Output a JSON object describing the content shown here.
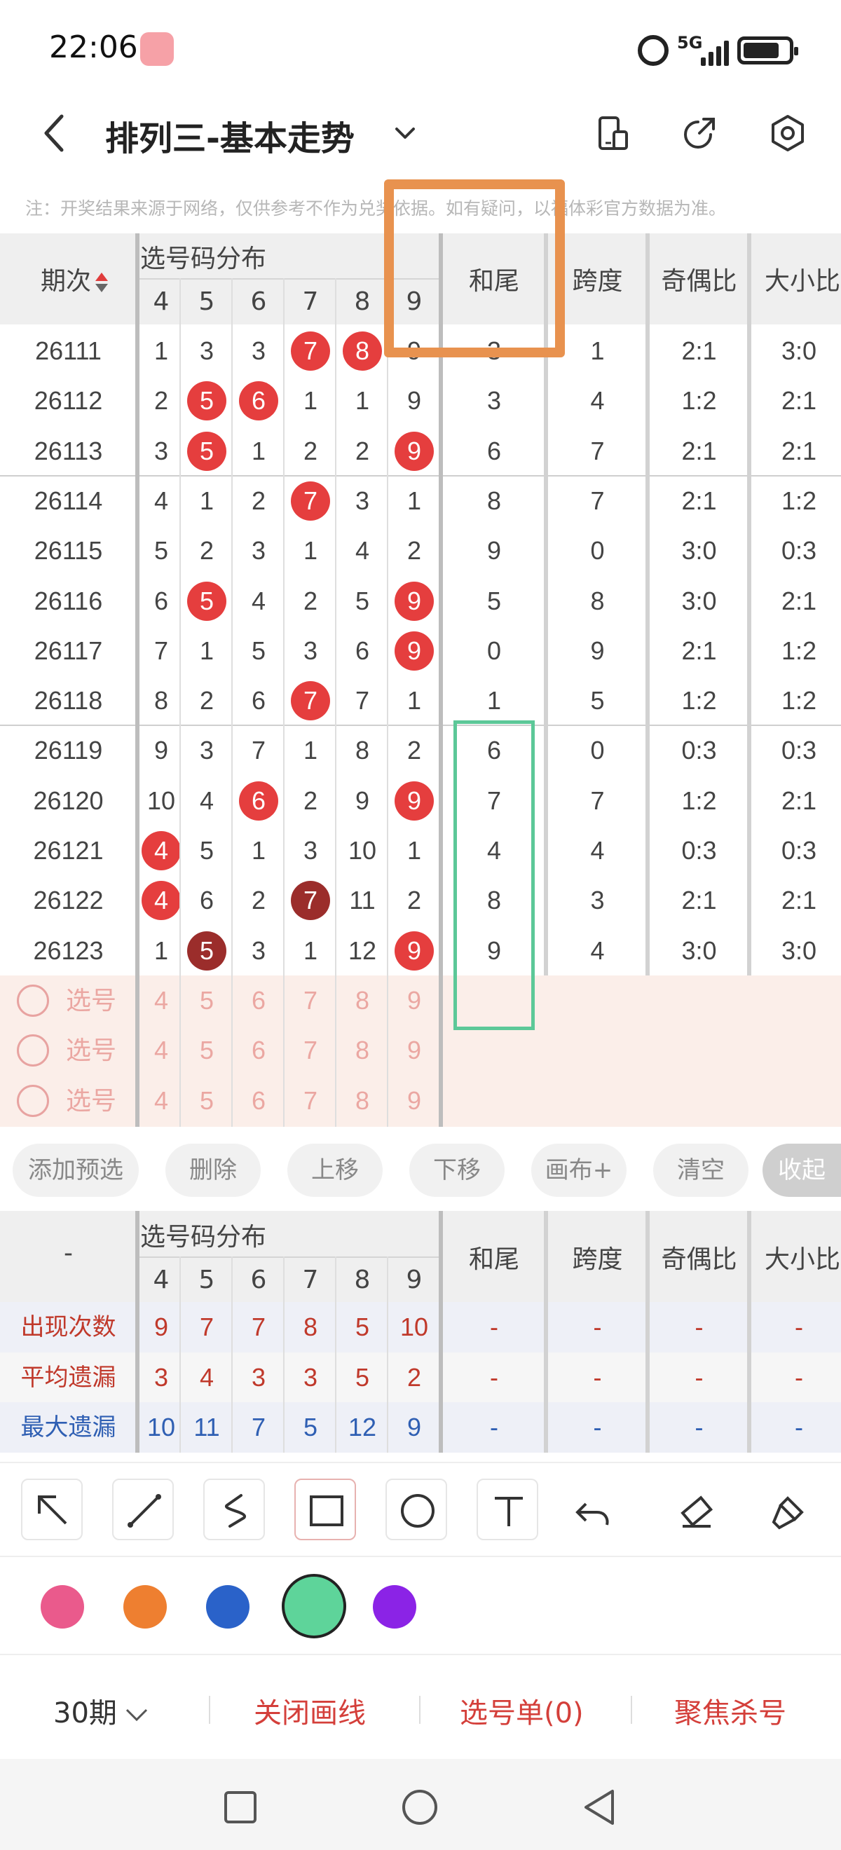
{
  "status_bar": {
    "time": "22:06",
    "network": "5G"
  },
  "header": {
    "title": "排列三-基本走势"
  },
  "notice": "注：开奖结果来源于网络，仅供参考不作为兑奖依据。如有疑问，以福体彩官方数据为准。",
  "table": {
    "col_period": "期次",
    "col_group": "选号码分布",
    "digits": [
      "4",
      "5",
      "6",
      "7",
      "8",
      "9"
    ],
    "col_hewei": "和尾",
    "col_kuadu": "跨度",
    "col_jiou": "奇偶比",
    "col_daxiao": "大小比",
    "rows": [
      {
        "period": "26111",
        "nums": [
          "1",
          "3",
          "3",
          "7",
          "8",
          "9"
        ],
        "hits": [
          0,
          0,
          0,
          1,
          1,
          0
        ],
        "hewei": "3",
        "kuadu": "1",
        "jiou": "2:1",
        "daxiao": "3:0"
      },
      {
        "period": "26112",
        "nums": [
          "2",
          "5",
          "6",
          "1",
          "1",
          "9"
        ],
        "hits": [
          0,
          1,
          1,
          0,
          0,
          0
        ],
        "hewei": "3",
        "kuadu": "4",
        "jiou": "1:2",
        "daxiao": "2:1"
      },
      {
        "period": "26113",
        "nums": [
          "3",
          "5",
          "1",
          "2",
          "2",
          "9"
        ],
        "hits": [
          0,
          1,
          0,
          0,
          0,
          1
        ],
        "hewei": "6",
        "kuadu": "7",
        "jiou": "2:1",
        "daxiao": "2:1"
      },
      {
        "period": "26114",
        "nums": [
          "4",
          "1",
          "2",
          "7",
          "3",
          "1"
        ],
        "hits": [
          0,
          0,
          0,
          1,
          0,
          0
        ],
        "hewei": "8",
        "kuadu": "7",
        "jiou": "2:1",
        "daxiao": "1:2"
      },
      {
        "period": "26115",
        "nums": [
          "5",
          "2",
          "3",
          "1",
          "4",
          "2"
        ],
        "hits": [
          0,
          0,
          0,
          0,
          0,
          0
        ],
        "hewei": "9",
        "kuadu": "0",
        "jiou": "3:0",
        "daxiao": "0:3"
      },
      {
        "period": "26116",
        "nums": [
          "6",
          "5",
          "4",
          "2",
          "5",
          "9"
        ],
        "hits": [
          0,
          1,
          0,
          0,
          0,
          1
        ],
        "hewei": "5",
        "kuadu": "8",
        "jiou": "3:0",
        "daxiao": "2:1"
      },
      {
        "period": "26117",
        "nums": [
          "7",
          "1",
          "5",
          "3",
          "6",
          "9"
        ],
        "hits": [
          0,
          0,
          0,
          0,
          0,
          1
        ],
        "hewei": "0",
        "kuadu": "9",
        "jiou": "2:1",
        "daxiao": "1:2"
      },
      {
        "period": "26118",
        "nums": [
          "8",
          "2",
          "6",
          "7",
          "7",
          "1"
        ],
        "hits": [
          0,
          0,
          0,
          1,
          0,
          0
        ],
        "hewei": "1",
        "kuadu": "5",
        "jiou": "1:2",
        "daxiao": "1:2"
      },
      {
        "period": "26119",
        "nums": [
          "9",
          "3",
          "7",
          "1",
          "8",
          "2"
        ],
        "hits": [
          0,
          0,
          0,
          0,
          0,
          0
        ],
        "hewei": "6",
        "kuadu": "0",
        "jiou": "0:3",
        "daxiao": "0:3"
      },
      {
        "period": "26120",
        "nums": [
          "10",
          "4",
          "6",
          "2",
          "9",
          "9"
        ],
        "hits": [
          0,
          0,
          1,
          0,
          0,
          1
        ],
        "hewei": "7",
        "kuadu": "7",
        "jiou": "1:2",
        "daxiao": "2:1"
      },
      {
        "period": "26121",
        "nums": [
          "4",
          "5",
          "1",
          "3",
          "10",
          "1"
        ],
        "hits": [
          1,
          0,
          0,
          0,
          0,
          0
        ],
        "hewei": "4",
        "kuadu": "4",
        "jiou": "0:3",
        "daxiao": "0:3"
      },
      {
        "period": "26122",
        "nums": [
          "4",
          "6",
          "2",
          "7",
          "11",
          "2"
        ],
        "hits": [
          1,
          0,
          0,
          2,
          0,
          0
        ],
        "hewei": "8",
        "kuadu": "3",
        "jiou": "2:1",
        "daxiao": "2:1"
      },
      {
        "period": "26123",
        "nums": [
          "1",
          "5",
          "3",
          "1",
          "12",
          "9"
        ],
        "hits": [
          0,
          2,
          0,
          0,
          0,
          1
        ],
        "hewei": "9",
        "kuadu": "4",
        "jiou": "3:0",
        "daxiao": "3:0"
      }
    ],
    "pick_label": "选号",
    "pick_rows": 3
  },
  "actions": [
    "添加预选",
    "删除",
    "上移",
    "下移",
    "画布+",
    "清空",
    "收起"
  ],
  "stats": {
    "dash": "-",
    "rows": [
      {
        "label": "出现次数",
        "color": "#c0392b",
        "values": [
          "9",
          "7",
          "7",
          "8",
          "5",
          "10"
        ]
      },
      {
        "label": "平均遗漏",
        "color": "#c0392b",
        "values": [
          "3",
          "4",
          "3",
          "3",
          "5",
          "2"
        ]
      },
      {
        "label": "最大遗漏",
        "color": "#2f5fb3",
        "values": [
          "10",
          "11",
          "7",
          "5",
          "12",
          "9"
        ]
      }
    ]
  },
  "tools": [
    "arrow-icon",
    "line-icon",
    "curve-icon",
    "rectangle-icon",
    "circle-icon",
    "text-icon",
    "undo-icon",
    "eraser-icon",
    "clear-brush-icon"
  ],
  "palette": [
    "#ea5a8c",
    "#ee7f30",
    "#2a62c9",
    "#5ed49a",
    "#8b23e6"
  ],
  "selected_color": "#5ed49a",
  "bottom": {
    "period": "30期",
    "close_line": "关闭画线",
    "pick_list": "选号单(0)",
    "focus": "聚焦杀号"
  },
  "colors": {
    "ball_red": "#e53e3e",
    "ball_dark": "#9b2d2b",
    "accent_red": "#d43f3a"
  }
}
